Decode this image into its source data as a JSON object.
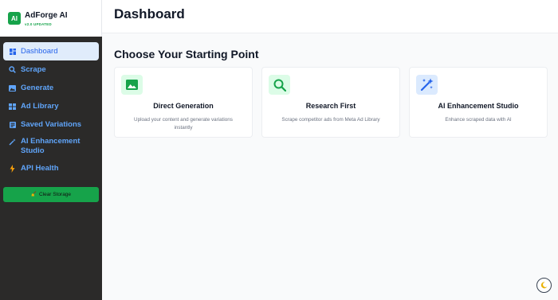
{
  "brand": {
    "logo": "AI",
    "name": "AdForge AI",
    "version": "v2.0 UPDATED"
  },
  "sidebar": {
    "items": [
      {
        "label": "Dashboard",
        "icon": "grid-icon"
      },
      {
        "label": "Scrape",
        "icon": "search-icon"
      },
      {
        "label": "Generate",
        "icon": "image-icon"
      },
      {
        "label": "Ad Library",
        "icon": "library-icon"
      },
      {
        "label": "Saved Variations",
        "icon": "bookmark-icon"
      },
      {
        "label": "AI Enhancement Studio",
        "icon": "magic-wand-icon"
      },
      {
        "label": "API Health",
        "icon": "lightning-icon"
      }
    ],
    "clear_storage": "Clear Storage"
  },
  "header": {
    "title": "Dashboard"
  },
  "main": {
    "section_title": "Choose Your Starting Point",
    "cards": [
      {
        "title": "Direct Generation",
        "description": "Upload your content and generate variations instantly",
        "icon": "image-icon"
      },
      {
        "title": "Research First",
        "description": "Scrape competitor ads from Meta Ad Library",
        "icon": "search-icon"
      },
      {
        "title": "AI Enhancement Studio",
        "description": "Enhance scraped data with AI",
        "icon": "sparkles-icon"
      }
    ]
  },
  "colors": {
    "brand_green": "#16a34a",
    "accent_blue": "#2563eb",
    "sidebar_bg": "#2b2a29"
  }
}
